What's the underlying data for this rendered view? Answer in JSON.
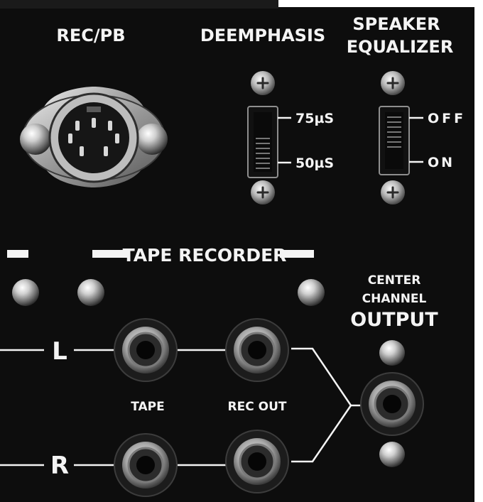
{
  "labels": {
    "rec_pb": "REC/PB",
    "deemphasis": "DEEMPHASIS",
    "speaker_line1": "SPEAKER",
    "speaker_line2": "EQUALIZER",
    "deemph_upper": "75µS",
    "deemph_lower": "50µS",
    "speq_upper": "OFF",
    "speq_lower": "ON",
    "tape_recorder": "TAPE RECORDER",
    "center_line1": "CENTER",
    "center_line2": "CHANNEL",
    "center_line3": "OUTPUT",
    "left": "L",
    "right": "R",
    "tape": "TAPE",
    "rec_out": "REC OUT"
  },
  "colors": {
    "panel": "#0d0d0d",
    "text": "#f4f4f4",
    "metal": "#c9c9c9"
  }
}
